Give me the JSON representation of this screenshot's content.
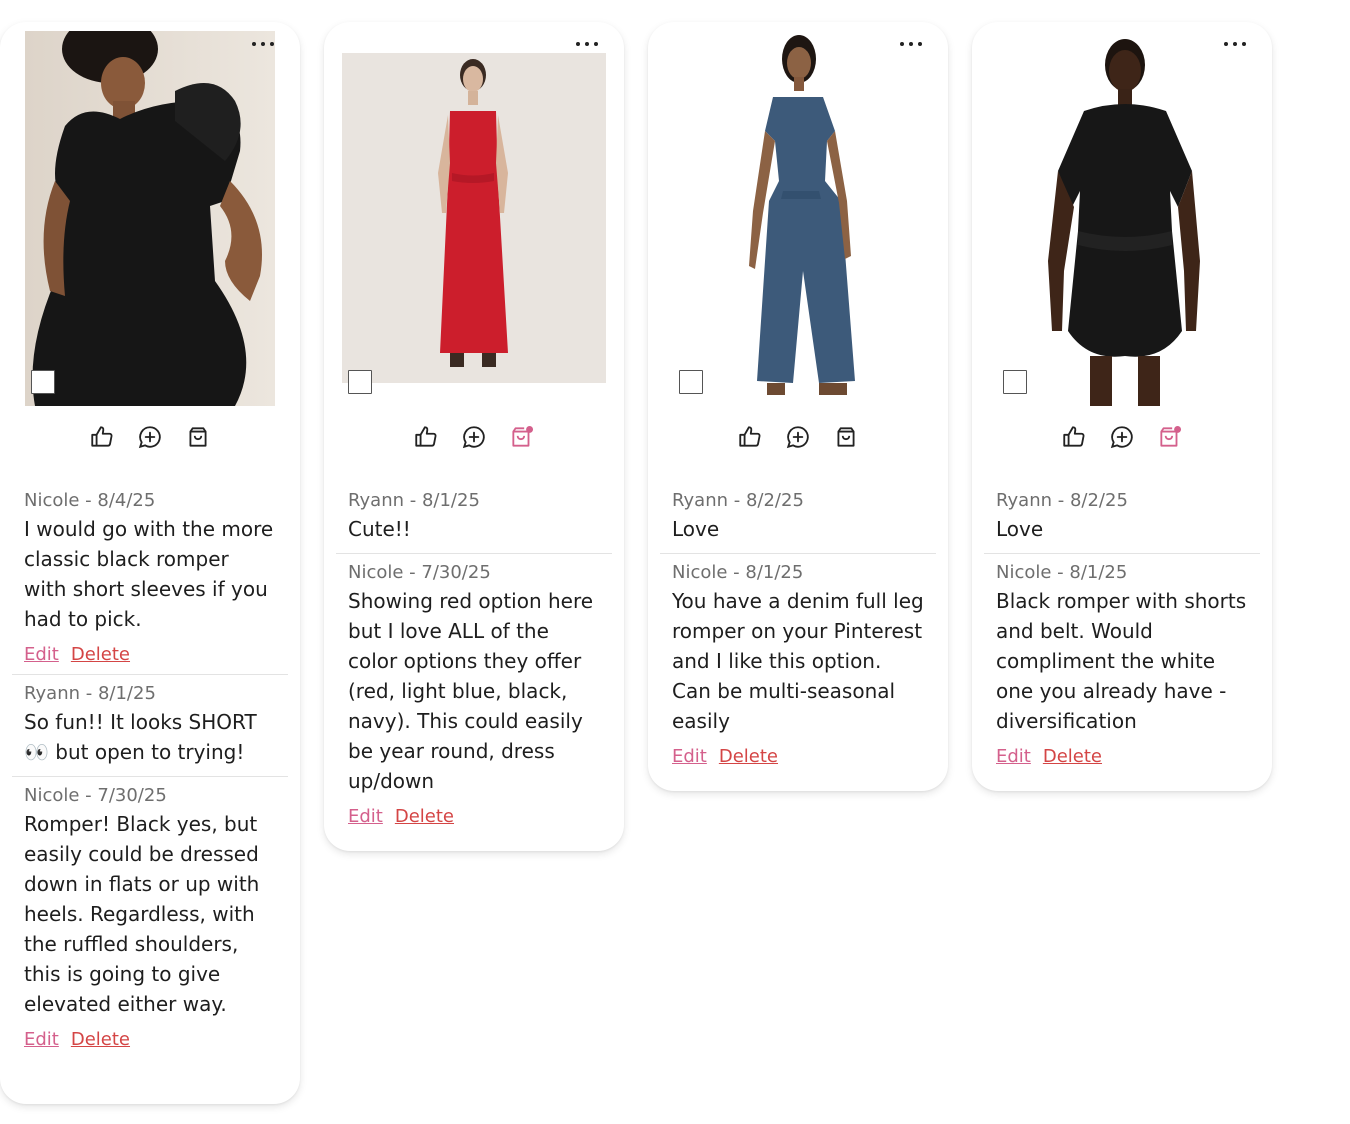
{
  "colors": {
    "accent_pink": "#d4608c",
    "delete_red": "#d44545",
    "meta_gray": "#6e6e6e",
    "card_bg": "#ffffff"
  },
  "icons": {
    "more": "ellipsis-icon",
    "like": "thumbs-up-icon",
    "comment": "add-comment-icon",
    "cart": "shopping-bag-icon",
    "cart_active": "shopping-bag-added-icon"
  },
  "cards": [
    {
      "image_alt": "black ruffled-sleeve romper",
      "cart_added": false,
      "comments": [
        {
          "meta": "Nicole - 8/4/25",
          "text": "I would go with the more classic black romper with short sleeves if you had to pick.",
          "edit": "Edit",
          "delete": "Delete"
        },
        {
          "meta": "Ryann - 8/1/25",
          "text": "So fun!! It looks SHORT 👀 but open to trying!",
          "edit": "",
          "delete": ""
        },
        {
          "meta": "Nicole - 7/30/25",
          "text": "Romper! Black yes, but easily could be dressed down in flats or up with heels. Regardless, with the ruffled shoulders, this is going to give elevated either way.",
          "edit": "Edit",
          "delete": "Delete"
        }
      ]
    },
    {
      "image_alt": "red wide-leg jumpsuit",
      "cart_added": true,
      "comments": [
        {
          "meta": "Ryann - 8/1/25",
          "text": "Cute!!",
          "edit": "",
          "delete": ""
        },
        {
          "meta": "Nicole - 7/30/25",
          "text": "Showing red option here but I love ALL of the color options they offer (red, light blue, black, navy). This could easily be year round, dress up/down",
          "edit": "Edit",
          "delete": "Delete"
        }
      ]
    },
    {
      "image_alt": "denim full leg romper",
      "cart_added": false,
      "comments": [
        {
          "meta": "Ryann - 8/2/25",
          "text": "Love",
          "edit": "",
          "delete": ""
        },
        {
          "meta": "Nicole - 8/1/25",
          "text": "You have a denim full leg romper on your Pinterest and I like this option. Can be multi-seasonal easily",
          "edit": "Edit",
          "delete": "Delete"
        }
      ]
    },
    {
      "image_alt": "black belted shorts romper",
      "cart_added": true,
      "comments": [
        {
          "meta": "Ryann - 8/2/25",
          "text": "Love",
          "edit": "",
          "delete": ""
        },
        {
          "meta": "Nicole - 8/1/25",
          "text": "Black romper with shorts and belt. Would compliment the white one you already have - diversification",
          "edit": "Edit",
          "delete": "Delete"
        }
      ]
    }
  ]
}
